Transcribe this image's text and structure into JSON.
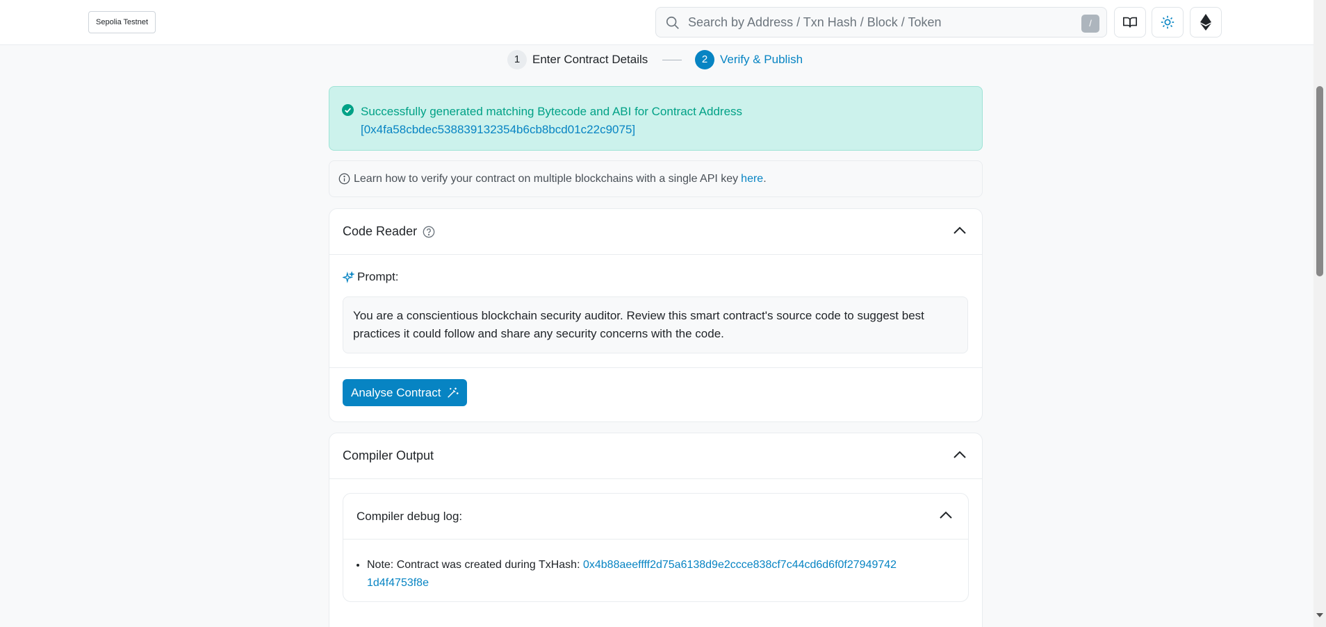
{
  "header": {
    "network_badge": "Sepolia Testnet",
    "search": {
      "placeholder": "Search by Address / Txn Hash / Block / Token",
      "shortcut": "/"
    },
    "buttons": [
      {
        "icon": "book-icon"
      },
      {
        "icon": "sun-icon"
      },
      {
        "icon": "ethereum-icon"
      }
    ]
  },
  "stepper": {
    "steps": [
      {
        "number": "1",
        "label": "Enter Contract Details",
        "state": "done"
      },
      {
        "number": "2",
        "label": "Verify & Publish",
        "state": "active"
      }
    ]
  },
  "alert": {
    "message": "Successfully generated matching Bytecode and ABI for Contract Address",
    "address": "[0x4fa58cbdec538839132354b6cb8bcd01c22c9075]"
  },
  "info": {
    "text": "Learn how to verify your contract on multiple blockchains with a single API key",
    "link": "here",
    "suffix": "."
  },
  "code_reader": {
    "title": "Code Reader",
    "prompt_label": "Prompt:",
    "prompt_text": "You are a conscientious blockchain security auditor. Review this smart contract's source code to suggest best practices it could follow and share any security concerns with the code.",
    "button_label": "Analyse Contract"
  },
  "compiler_output": {
    "title": "Compiler Output",
    "debug_log": {
      "title": "Compiler debug log:",
      "note_prefix": "Note: Contract was created during TxHash:",
      "tx_hash_line1": "0x4b88aeeffff2d75a6138d9e2ccce838cf7c44cd6d6f0f27949742",
      "tx_hash_line2": "1d4f4753f8e"
    }
  },
  "colors": {
    "accent": "#0784c3",
    "success_bg": "#ccf2ec",
    "success_text": "#00a186"
  }
}
